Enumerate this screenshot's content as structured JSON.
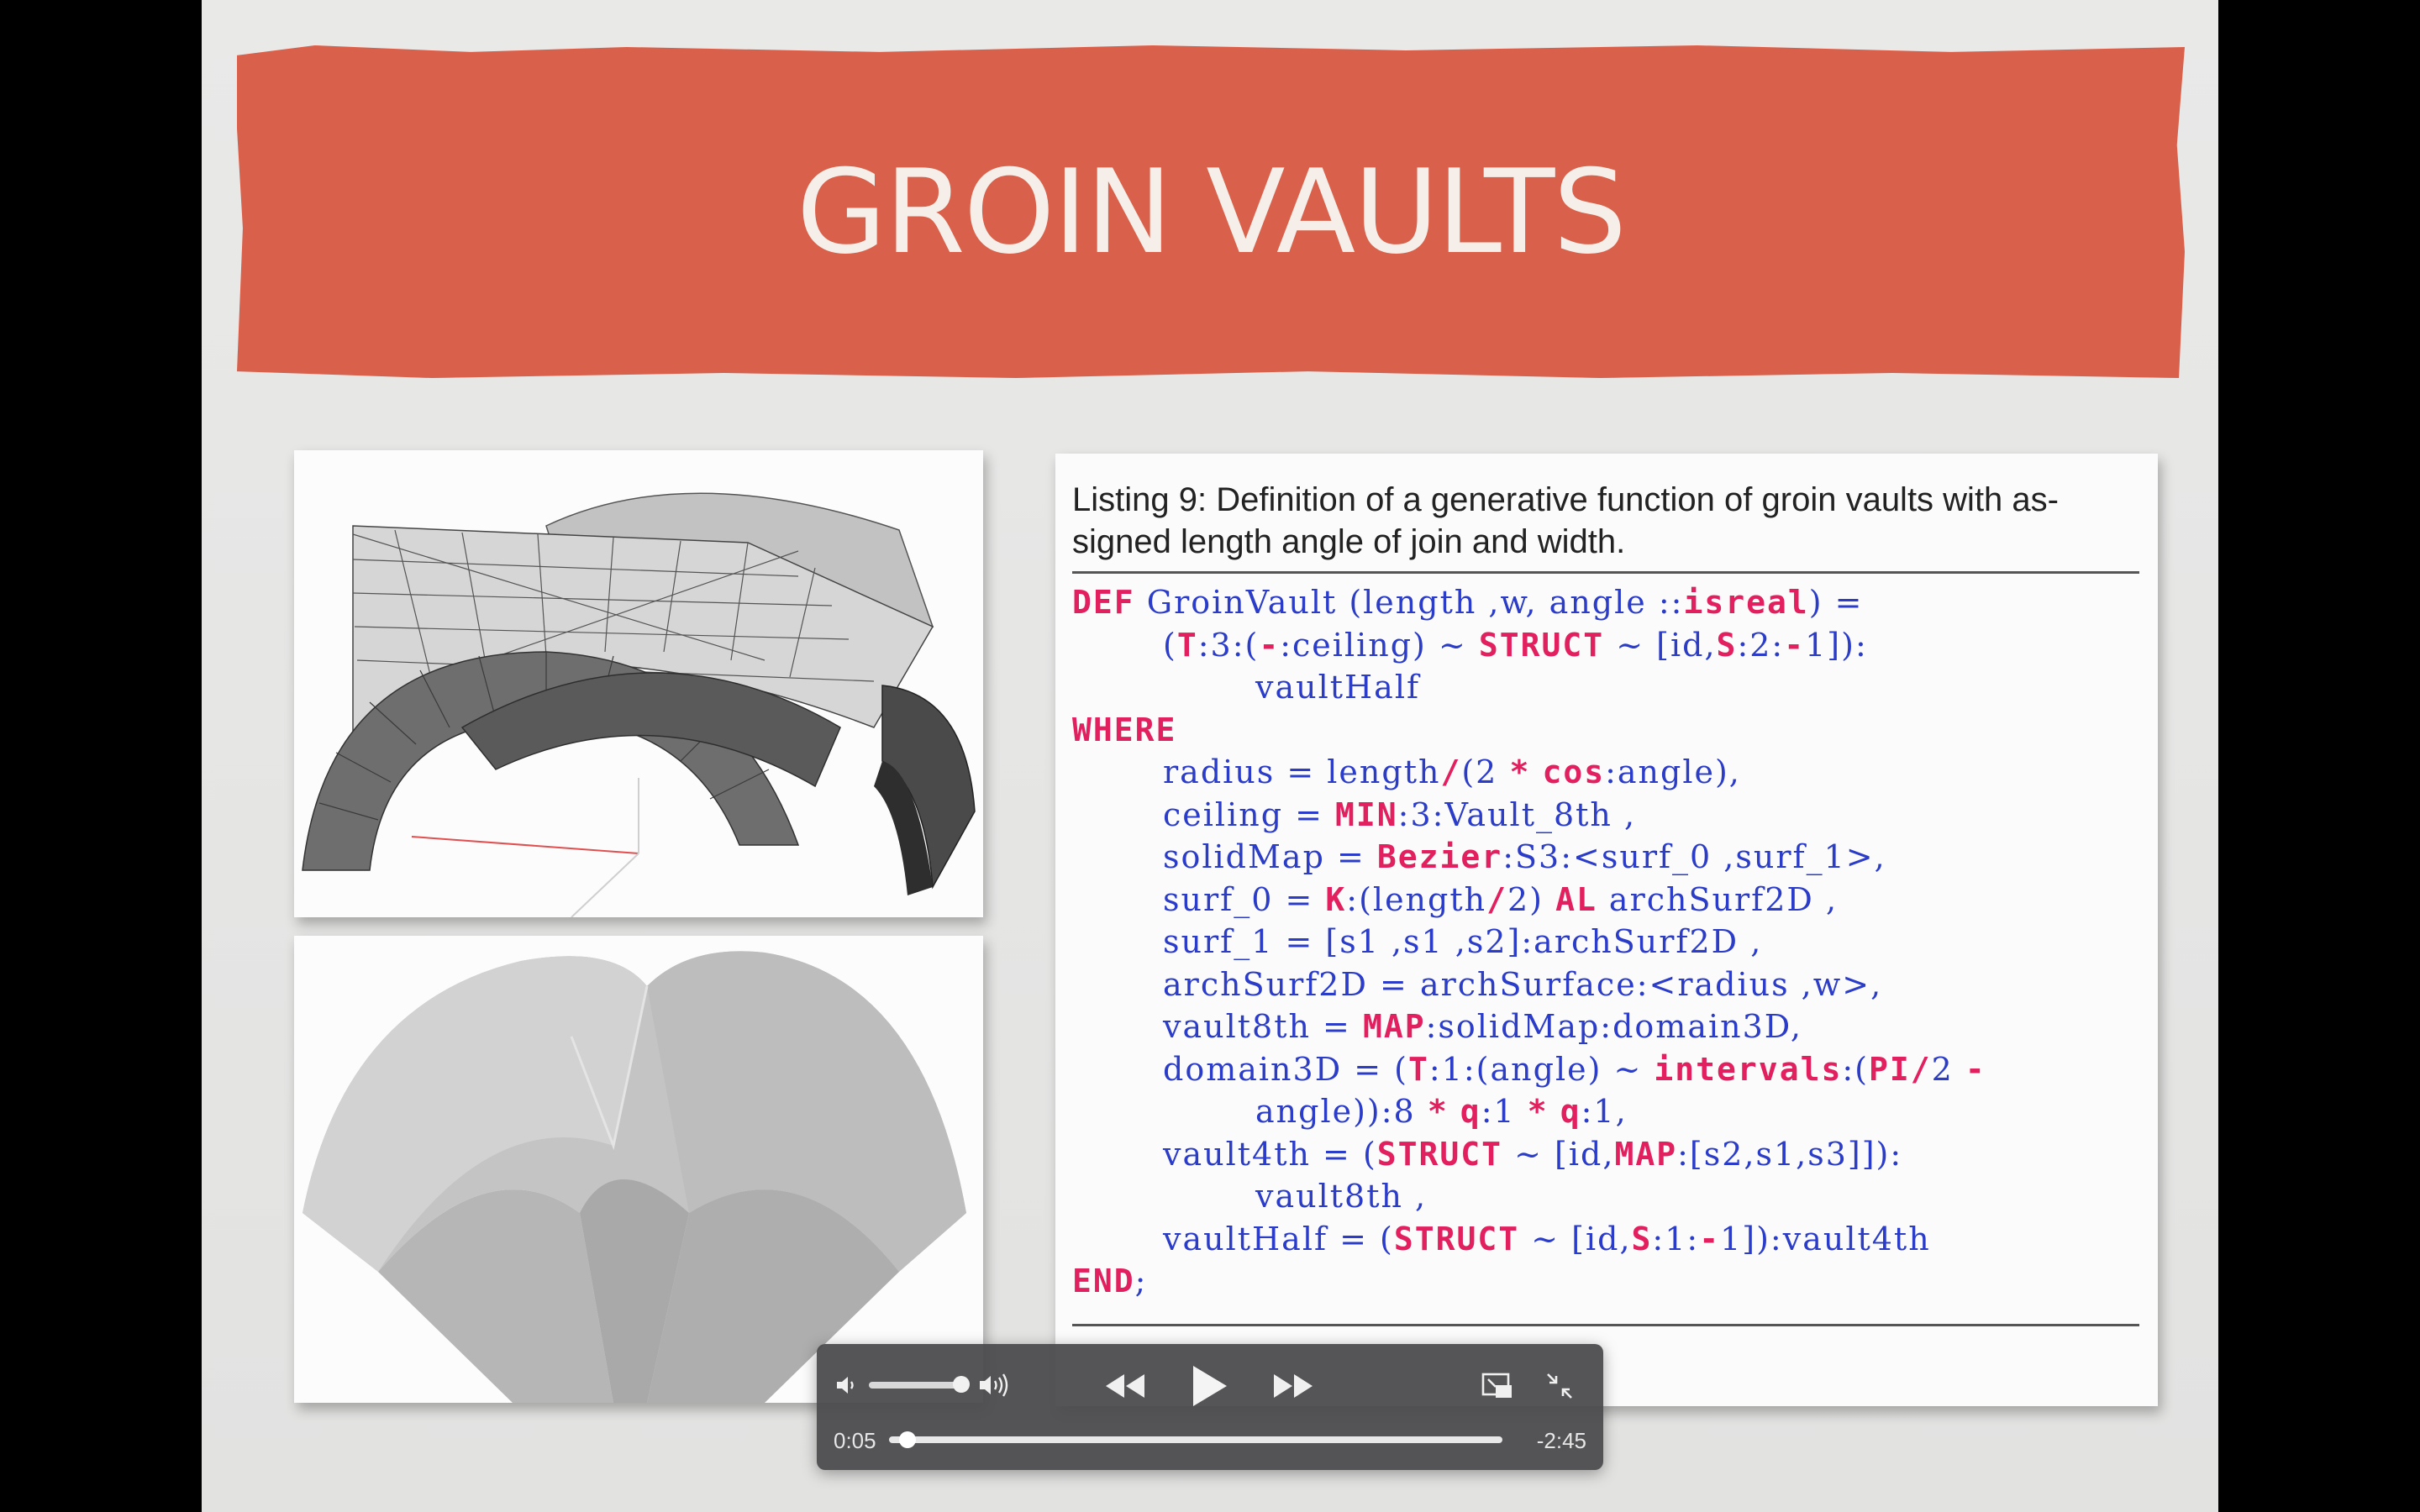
{
  "slide": {
    "title": "GROIN VAULTS",
    "banner_color": "#d9604a"
  },
  "listing": {
    "caption_line1": "Listing 9: Definition of a generative function of groin vaults with as-",
    "caption_line2": "signed length angle of join and width."
  },
  "player": {
    "current_time": "0:05",
    "remaining_time": "-2:45",
    "progress": 0.03,
    "volume": 0.9,
    "icons": [
      "volume-low-icon",
      "volume-high-icon",
      "rewind-icon",
      "play-icon",
      "fast-forward-icon",
      "picture-in-picture-icon",
      "exit-fullscreen-icon"
    ]
  }
}
